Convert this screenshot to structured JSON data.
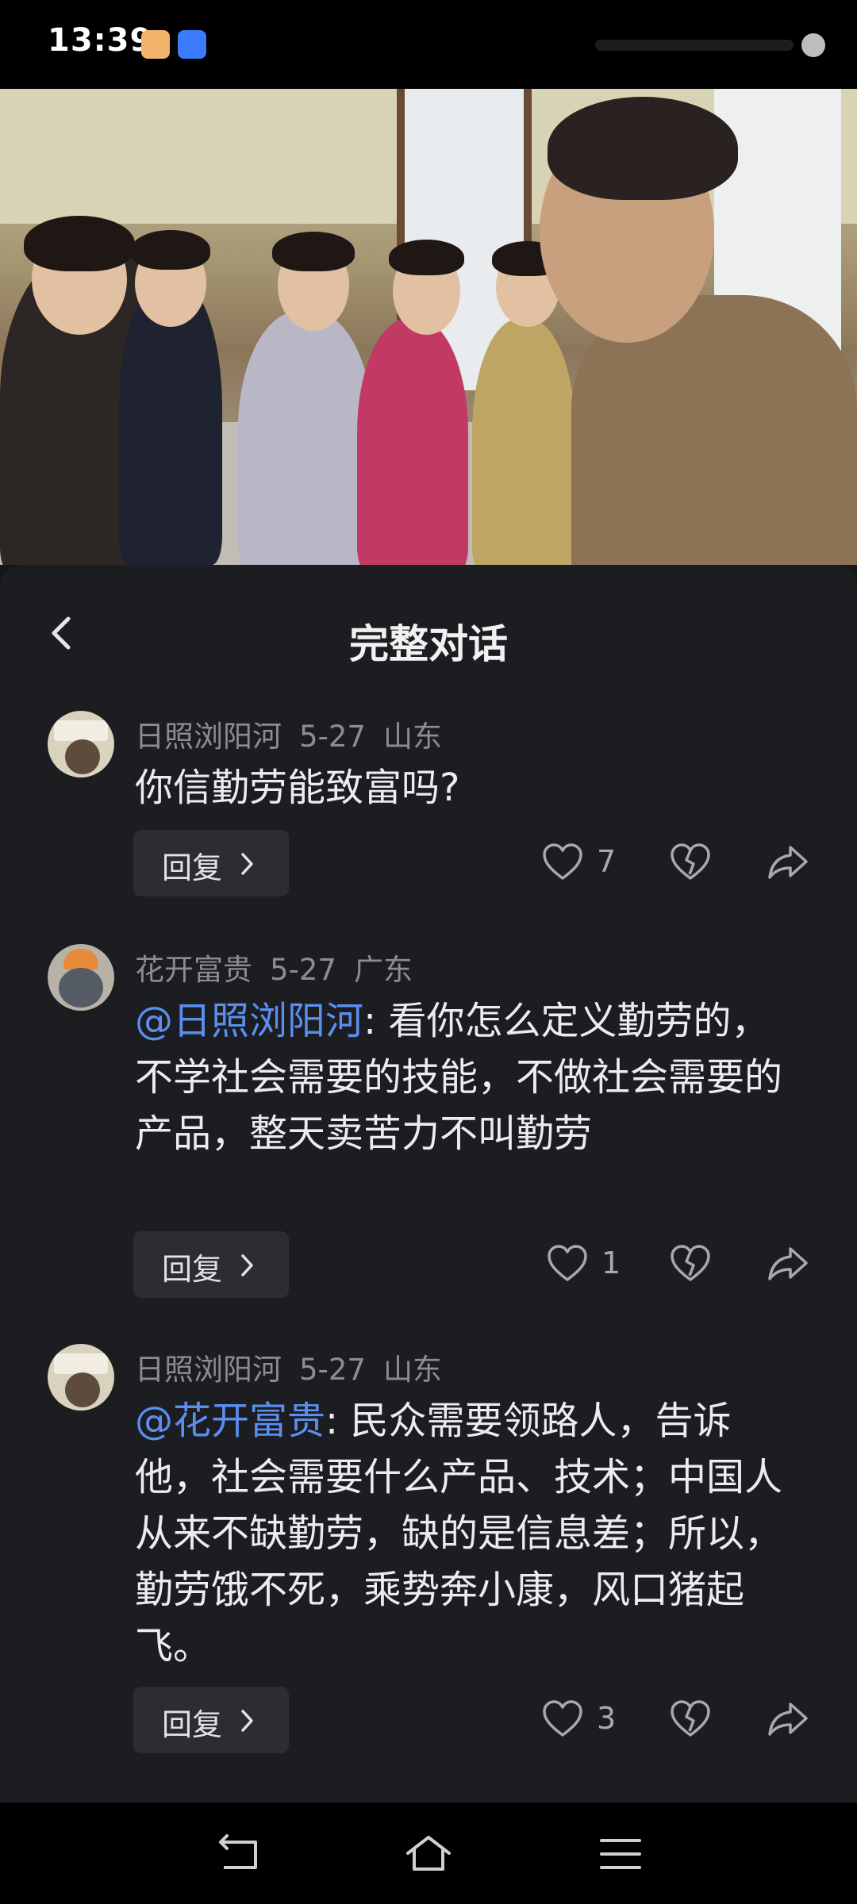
{
  "status_bar": {
    "time": "13:39"
  },
  "sheet": {
    "title": "完整对话"
  },
  "comments": [
    {
      "user": "日照浏阳河",
      "date": "5-27",
      "location": "山东",
      "mention": "",
      "text": "你信勤劳能致富吗?",
      "reply_label": "回复",
      "likes": "7"
    },
    {
      "user": "花开富贵",
      "date": "5-27",
      "location": "广东",
      "mention": "@日照浏阳河",
      "text": ": 看你怎么定义勤劳的，不学社会需要的技能，不做社会需要的产品，整天卖苦力不叫勤劳",
      "reply_label": "回复",
      "likes": "1"
    },
    {
      "user": "日照浏阳河",
      "date": "5-27",
      "location": "山东",
      "mention": "@花开富贵",
      "text": ": 民众需要领路人，告诉他，社会需要什么产品、技术；中国人从来不缺勤劳，缺的是信息差；所以，勤劳饿不死，乘势奔小康，风口猪起飞。",
      "reply_label": "回复",
      "likes": "3"
    }
  ],
  "icons": {
    "back": "chevron-left-icon",
    "like": "heart-outline-icon",
    "dislike": "broken-heart-icon",
    "share": "share-arrow-icon",
    "nav_back": "back-arrow-icon",
    "nav_home": "home-icon",
    "nav_menu": "menu-icon"
  },
  "colors": {
    "mention": "#5a8ff0",
    "sheet_bg": "#1c1d21"
  }
}
